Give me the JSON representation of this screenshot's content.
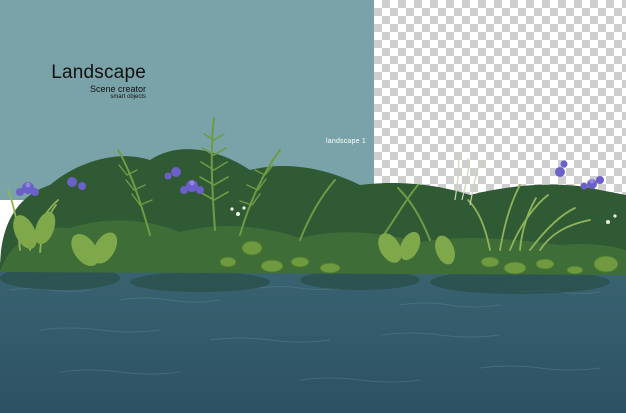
{
  "header": {
    "title": "Landscape",
    "subtitle": "Scene creator",
    "tagline": "smart objects"
  },
  "preview_label": "landscape 1",
  "colors": {
    "sky": "#79a3a8",
    "water_top": "#3c6470",
    "water_bottom": "#2e5464",
    "foliage_dark": "#2f5a34",
    "foliage_mid": "#4d7f3d",
    "foliage_light": "#8fb35a",
    "iris": "#6b5fc9"
  }
}
